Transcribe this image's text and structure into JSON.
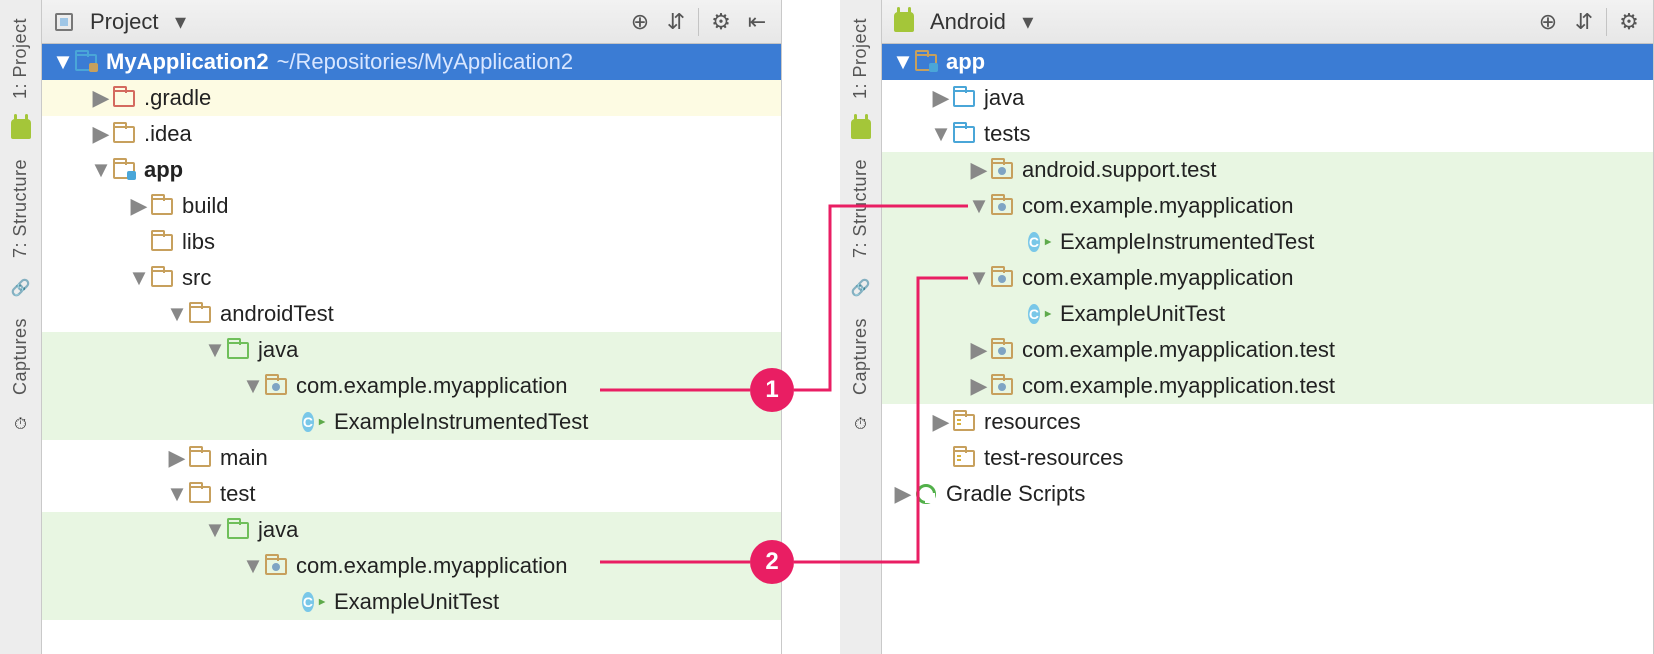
{
  "gutter": {
    "tab_project": "1: Project",
    "tab_structure": "7: Structure",
    "tab_captures": "Captures"
  },
  "left": {
    "header": {
      "title": "Project"
    },
    "rows": [
      {
        "depth": 0,
        "disc": "down",
        "icon": "folder-proj",
        "label": "MyApplication2",
        "bold": true,
        "suffix": "~/Repositories/MyApplication2",
        "sel": true
      },
      {
        "depth": 1,
        "disc": "right",
        "icon": "folder-red",
        "label": ".gradle",
        "hly": true
      },
      {
        "depth": 1,
        "disc": "right",
        "icon": "folder-tan",
        "label": ".idea"
      },
      {
        "depth": 1,
        "disc": "down",
        "icon": "folder-mod",
        "label": "app",
        "bold": true
      },
      {
        "depth": 2,
        "disc": "right",
        "icon": "folder-tan",
        "label": "build"
      },
      {
        "depth": 2,
        "disc": "",
        "icon": "folder-tan",
        "label": "libs"
      },
      {
        "depth": 2,
        "disc": "down",
        "icon": "folder-tan",
        "label": "src"
      },
      {
        "depth": 3,
        "disc": "down",
        "icon": "folder-tan",
        "label": "androidTest"
      },
      {
        "depth": 4,
        "disc": "down",
        "icon": "folder-green",
        "label": "java",
        "hl": true
      },
      {
        "depth": 5,
        "disc": "down",
        "icon": "pkg",
        "label": "com.example.myapplication",
        "hl": true
      },
      {
        "depth": 6,
        "disc": "",
        "icon": "class",
        "label": "ExampleInstrumentedTest",
        "hl": true
      },
      {
        "depth": 3,
        "disc": "right",
        "icon": "folder-tan",
        "label": "main"
      },
      {
        "depth": 3,
        "disc": "down",
        "icon": "folder-tan",
        "label": "test"
      },
      {
        "depth": 4,
        "disc": "down",
        "icon": "folder-green",
        "label": "java",
        "hl": true
      },
      {
        "depth": 5,
        "disc": "down",
        "icon": "pkg",
        "label": "com.example.myapplication",
        "hl": true
      },
      {
        "depth": 6,
        "disc": "",
        "icon": "class",
        "label": "ExampleUnitTest",
        "hl": true
      }
    ]
  },
  "right": {
    "header": {
      "title": "Android"
    },
    "rows": [
      {
        "depth": 0,
        "disc": "down",
        "icon": "folder-mod",
        "label": "app",
        "bold": true,
        "sel": true
      },
      {
        "depth": 1,
        "disc": "right",
        "icon": "folder-blue",
        "label": "java"
      },
      {
        "depth": 1,
        "disc": "down",
        "icon": "folder-blue",
        "label": "tests"
      },
      {
        "depth": 2,
        "disc": "right",
        "icon": "pkg",
        "label": "android.support.test",
        "hl": true
      },
      {
        "depth": 2,
        "disc": "down",
        "icon": "pkg",
        "label": "com.example.myapplication",
        "hl": true
      },
      {
        "depth": 3,
        "disc": "",
        "icon": "class",
        "label": "ExampleInstrumentedTest",
        "hl": true
      },
      {
        "depth": 2,
        "disc": "down",
        "icon": "pkg",
        "label": "com.example.myapplication",
        "hl": true
      },
      {
        "depth": 3,
        "disc": "",
        "icon": "class",
        "label": "ExampleUnitTest",
        "hl": true
      },
      {
        "depth": 2,
        "disc": "right",
        "icon": "pkg",
        "label": "com.example.myapplication.test",
        "hl": true
      },
      {
        "depth": 2,
        "disc": "right",
        "icon": "pkg",
        "label": "com.example.myapplication.test",
        "hl": true
      },
      {
        "depth": 1,
        "disc": "right",
        "icon": "folder-res",
        "label": "resources"
      },
      {
        "depth": 1,
        "disc": "",
        "icon": "folder-res",
        "label": "test-resources"
      },
      {
        "depth": 0,
        "disc": "right",
        "icon": "gradle",
        "label": "Gradle Scripts"
      }
    ]
  },
  "callouts": {
    "one": "1",
    "two": "2"
  }
}
